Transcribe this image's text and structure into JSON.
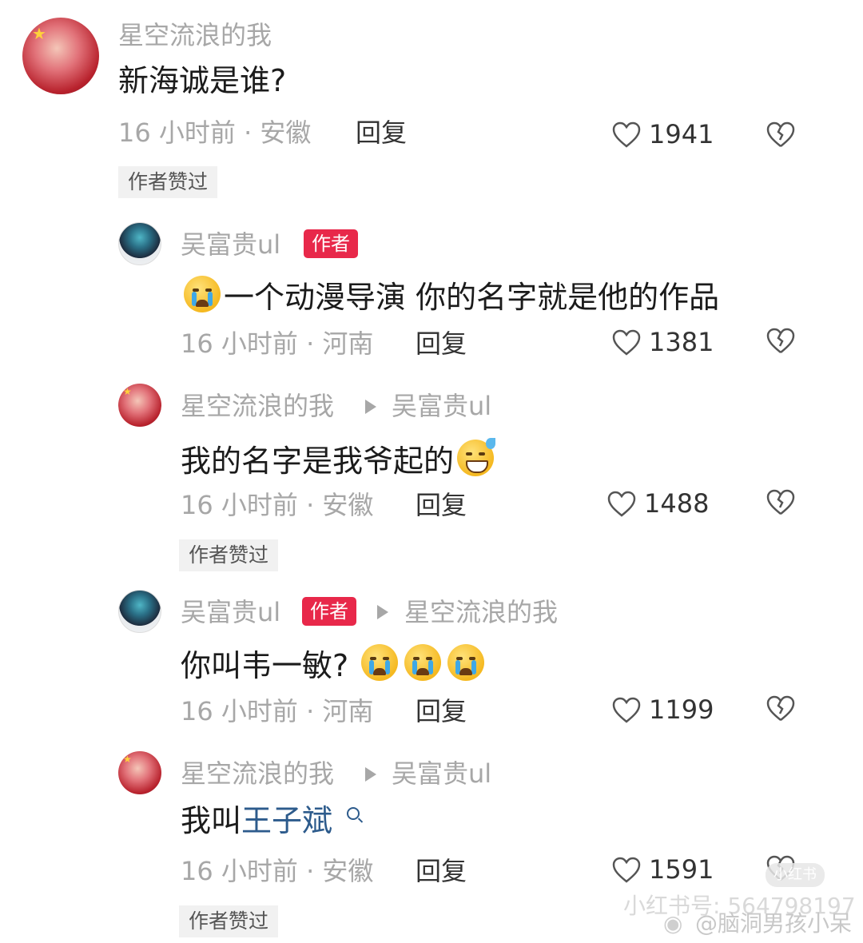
{
  "comments": [
    {
      "user": "星空流浪的我",
      "text": "新海诚是谁?",
      "meta": "16 小时前 · 安徽",
      "reply_label": "回复",
      "likes": "1941",
      "badge": "作者赞过"
    },
    {
      "user": "吴富贵ul",
      "author_tag": "作者",
      "text": "一个动漫导演 你的名字就是他的作品",
      "emoji": "loudly-crying-face",
      "meta": "16 小时前 · 河南",
      "reply_label": "回复",
      "likes": "1381"
    },
    {
      "user": "星空流浪的我",
      "reply_to": "吴富贵ul",
      "text": "我的名字是我爷起的",
      "emoji": "grinning-face-with-sweat",
      "meta": "16 小时前 · 安徽",
      "reply_label": "回复",
      "likes": "1488",
      "badge": "作者赞过"
    },
    {
      "user": "吴富贵ul",
      "author_tag": "作者",
      "reply_to": "星空流浪的我",
      "text": "你叫韦一敏?",
      "emoji": "loudly-crying-face x3",
      "meta": "16 小时前 · 河南",
      "reply_label": "回复",
      "likes": "1199"
    },
    {
      "user": "星空流浪的我",
      "reply_to": "吴富贵ul",
      "text_prefix": "我叫",
      "text_link": "王子斌",
      "meta": "16 小时前 · 安徽",
      "reply_label": "回复",
      "likes": "1591",
      "badge": "作者赞过"
    }
  ],
  "watermark": {
    "xhs_id": "小红书号: 564798197",
    "weibo": "@脑洞男孩小呆",
    "xhs_badge": "小红书"
  },
  "colors": {
    "author_tag": "#e8284a",
    "link": "#2d5b8c",
    "muted": "#a7a7a7"
  }
}
